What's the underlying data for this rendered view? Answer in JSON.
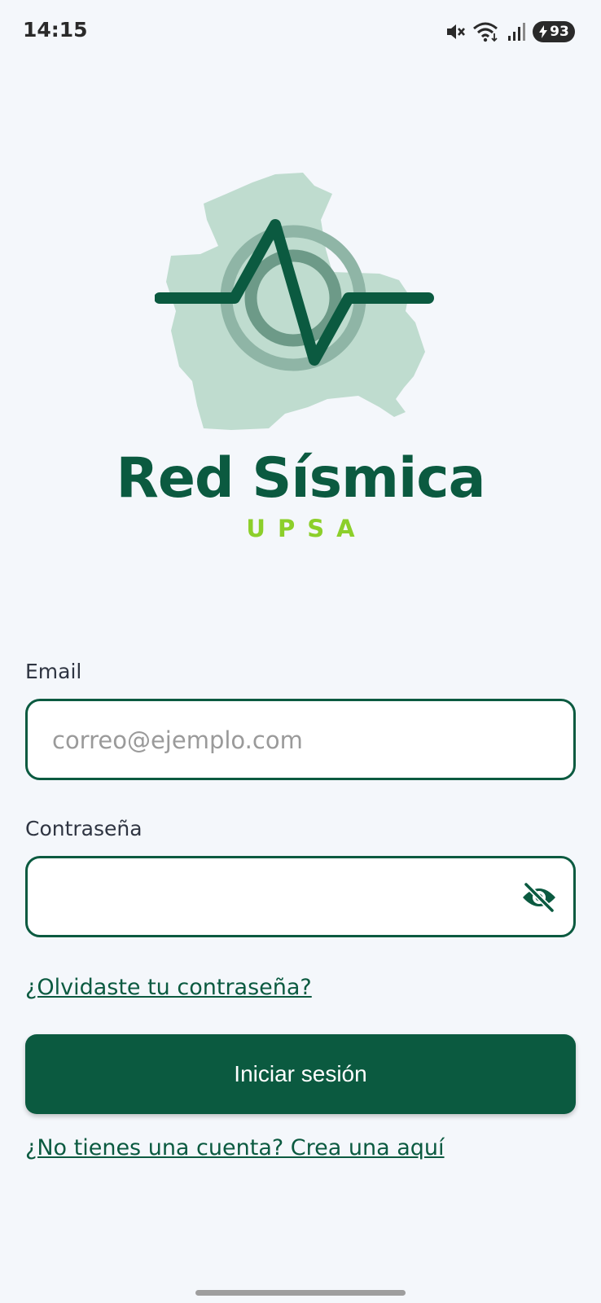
{
  "status_bar": {
    "time": "14:15",
    "battery_level": "93"
  },
  "brand": {
    "title": "Red Sísmica",
    "subtitle": "UPSA",
    "primary_color": "#0b5a40",
    "accent_color": "#8ccf2a"
  },
  "form": {
    "email": {
      "label": "Email",
      "value": "",
      "placeholder": "correo@ejemplo.com"
    },
    "password": {
      "label": "Contraseña",
      "value": "",
      "placeholder": "",
      "toggle_icon": "eye-off-icon"
    },
    "forgot_link": "¿Olvidaste tu contraseña?",
    "submit_label": "Iniciar sesión",
    "register_link": "¿No tienes una cuenta? Crea una aquí"
  }
}
